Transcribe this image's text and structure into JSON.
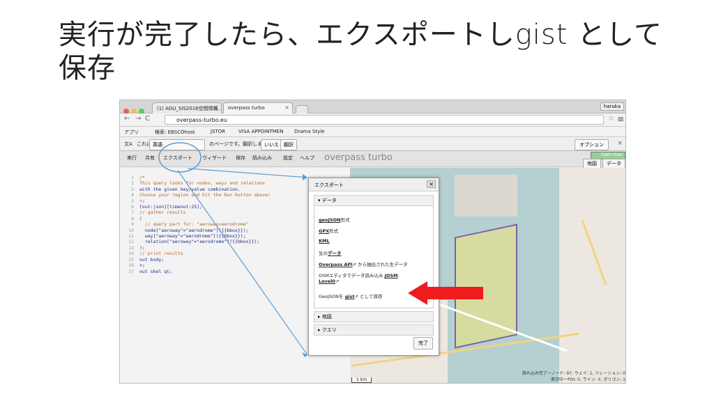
{
  "slide": {
    "title": "実行が完了したら、エクスポートしgist として保存"
  },
  "browser": {
    "tabs": [
      "(1) AGU_SIS2016空間情報…",
      "overpass turbo"
    ],
    "user": "haruka",
    "url": "overpass-turbo.eu",
    "bookmarks": [
      "アプリ",
      "検索: EBSCOhost",
      "JSTOR",
      "VISA APPOINTMEN",
      "Drama Style"
    ]
  },
  "translate": {
    "prefix": "これは",
    "lang": "英語",
    "question": "のページです。翻訳しますか？",
    "no": "いいえ",
    "translate": "翻訳",
    "options": "オプション"
  },
  "toolbar": {
    "items": [
      "実行",
      "共有",
      "エクスポート",
      "ウィザード",
      "保存",
      "読み込み",
      "設定",
      "ヘルプ"
    ],
    "brand": "overpass turbo",
    "run_label": "Flattr this!",
    "map_tab": "地図",
    "data_tab": "データ"
  },
  "editor": {
    "lines": [
      "1",
      "2",
      "3",
      "4",
      "5",
      "6",
      "7",
      "8",
      "9",
      "10",
      "11",
      "12",
      "13",
      "14",
      "15",
      "16",
      "17"
    ],
    "code": "/*\nThis query looks for nodes, ways and relations\nwith the given key/value combination.\nChoose your region and hit the Run button above!\n*/\n[out:json][timeout:25];\n// gather results\n(\n  // query part for: \"aeroway=aerodrome\"\n  node[\"aeroway\"=\"aerodrome\"]({{bbox}});\n  way[\"aeroway\"=\"aerodrome\"]({{bbox}});\n  relation[\"aeroway\"=\"aerodrome\"]({{bbox}});\n);\n// print results\nout body;\n>;\nout skel qt;"
  },
  "dialog": {
    "title": "エクスポート",
    "section_data": "▾ データ",
    "items": {
      "geojson": "geoJSON",
      "geojson_suffix": "形式",
      "gpx": "GPX",
      "gpx_suffix": "形式",
      "kml": "KML",
      "raw_prefix": "生の",
      "raw": "データ",
      "overpass": "Overpass API",
      "overpass_suffix": " から抽出された生データ",
      "josm_prefix": "OSMエディタでデータ読み込み ",
      "josm": "JOSM",
      "level0": "Level0",
      "gist_prefix": "GeoJSONを ",
      "gist": "gist",
      "gist_suffix": " として保存"
    },
    "section_map": "▸ 地図",
    "section_query": "▸ クエリ",
    "done": "完了"
  },
  "map": {
    "info1": "読み込み完了ーノード: 97, ウェイ: 1, リレーション: 0",
    "info2": "表示中ーPOI: 0, ライン: 0, ポリゴン: 1",
    "scale": "1 km"
  }
}
